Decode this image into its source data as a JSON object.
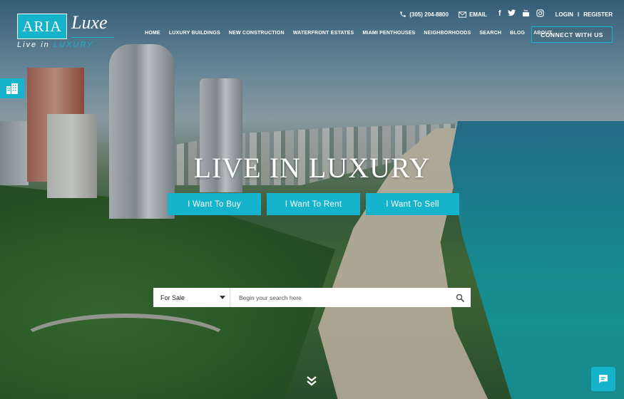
{
  "logo": {
    "box_text": "ARIA",
    "script_text": "Luxe",
    "tagline_start": "Live in",
    "tagline_end": "LUXURY"
  },
  "topbar": {
    "phone": "(305) 204-8800",
    "email": "EMAIL",
    "login": "LOGIN",
    "separator": "I",
    "register": "REGISTER",
    "social_icons": [
      "facebook-icon",
      "twitter-icon",
      "youtube-icon",
      "instagram-icon"
    ]
  },
  "nav": {
    "items": [
      "HOME",
      "LUXURY BUILDINGS",
      "NEW CONSTRUCTION",
      "WATERFRONT ESTATES",
      "MIAMI PENTHOUSES",
      "NEIGHBORHOODS",
      "SEARCH",
      "BLOG",
      "ABOUT"
    ]
  },
  "cta": {
    "connect": "CONNECT WITH US"
  },
  "hero": {
    "headline": "LIVE IN LUXURY",
    "buttons": [
      "I Want To Buy",
      "I Want To Rent",
      "I Want To Sell"
    ]
  },
  "search": {
    "select_value": "For Sale",
    "placeholder": "Begin your search here"
  },
  "colors": {
    "accent": "#15b3cc",
    "text": "#ffffff"
  }
}
